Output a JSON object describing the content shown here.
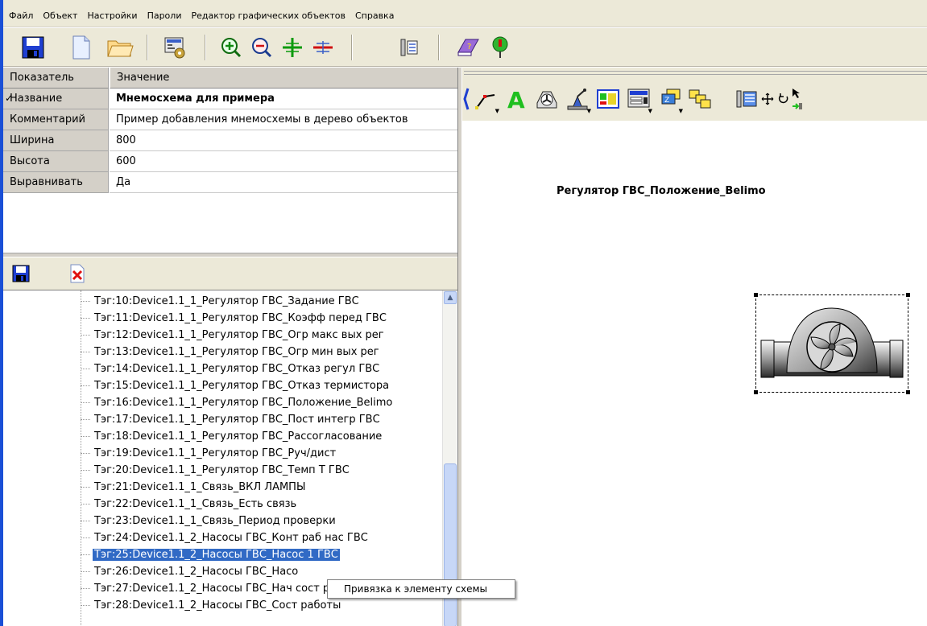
{
  "menu": {
    "items": [
      "Файл",
      "Объект",
      "Настройки",
      "Пароли",
      "Редактор графических объектов",
      "Справка"
    ]
  },
  "toolbar": {
    "icons": [
      "save-icon",
      "new-document-icon",
      "open-folder-icon",
      "settings-gear-icon",
      "zoom-in-icon",
      "zoom-out-icon",
      "grid-increase-icon",
      "grid-decrease-icon",
      "tools-icon",
      "help-book-icon",
      "info-icon"
    ]
  },
  "properties": {
    "header": {
      "key": "Показатель",
      "value": "Значение"
    },
    "rows": [
      {
        "key": "Название",
        "value": "Мнемосхема для примера",
        "checked": true
      },
      {
        "key": "Комментарий",
        "value": "Пример добавления мнемосхемы в дерево объектов"
      },
      {
        "key": "Ширина",
        "value": "800"
      },
      {
        "key": "Высота",
        "value": "600"
      },
      {
        "key": "Выравнивать",
        "value": "Да"
      }
    ]
  },
  "tree": {
    "items": [
      "Тэг:10:Device1.1_1_Регулятор ГВС_Задание ГВС",
      "Тэг:11:Device1.1_1_Регулятор ГВС_Коэфф перед ГВС",
      "Тэг:12:Device1.1_1_Регулятор ГВС_Огр макс вых рег",
      "Тэг:13:Device1.1_1_Регулятор ГВС_Огр мин вых рег",
      "Тэг:14:Device1.1_1_Регулятор ГВС_Отказ регул ГВС",
      "Тэг:15:Device1.1_1_Регулятор ГВС_Отказ термистора",
      "Тэг:16:Device1.1_1_Регулятор ГВС_Положение_Belimo",
      "Тэг:17:Device1.1_1_Регулятор ГВС_Пост интегр ГВС",
      "Тэг:18:Device1.1_1_Регулятор ГВС_Рассогласование",
      "Тэг:19:Device1.1_1_Регулятор ГВС_Руч/дист",
      "Тэг:20:Device1.1_1_Регулятор ГВС_Темп Т ГВС",
      "Тэг:21:Device1.1_1_Связь_ВКЛ ЛАМПЫ",
      "Тэг:22:Device1.1_1_Связь_Есть связь",
      "Тэг:23:Device1.1_1_Связь_Период проверки",
      "Тэг:24:Device1.1_2_Насосы ГВС_Конт раб нас ГВС",
      "Тэг:25:Device1.1_2_Насосы ГВС_Насос 1 ГВС",
      "Тэг:26:Device1.1_2_Насосы ГВС_Насо",
      "Тэг:27:Device1.1_2_Насосы ГВС_Нач сост работы насосс",
      "Тэг:28:Device1.1_2_Насосы ГВС_Сост работы"
    ],
    "selected_index": 15
  },
  "canvas": {
    "label": "Регулятор ГВС_Положение_Belimo"
  },
  "context_menu": {
    "item": "Привязка к элементу схемы"
  },
  "colors": {
    "selection": "#316ac5",
    "panel": "#ece9d8",
    "header": "#d4d0c8",
    "left_edge": "#1a4fd6"
  }
}
